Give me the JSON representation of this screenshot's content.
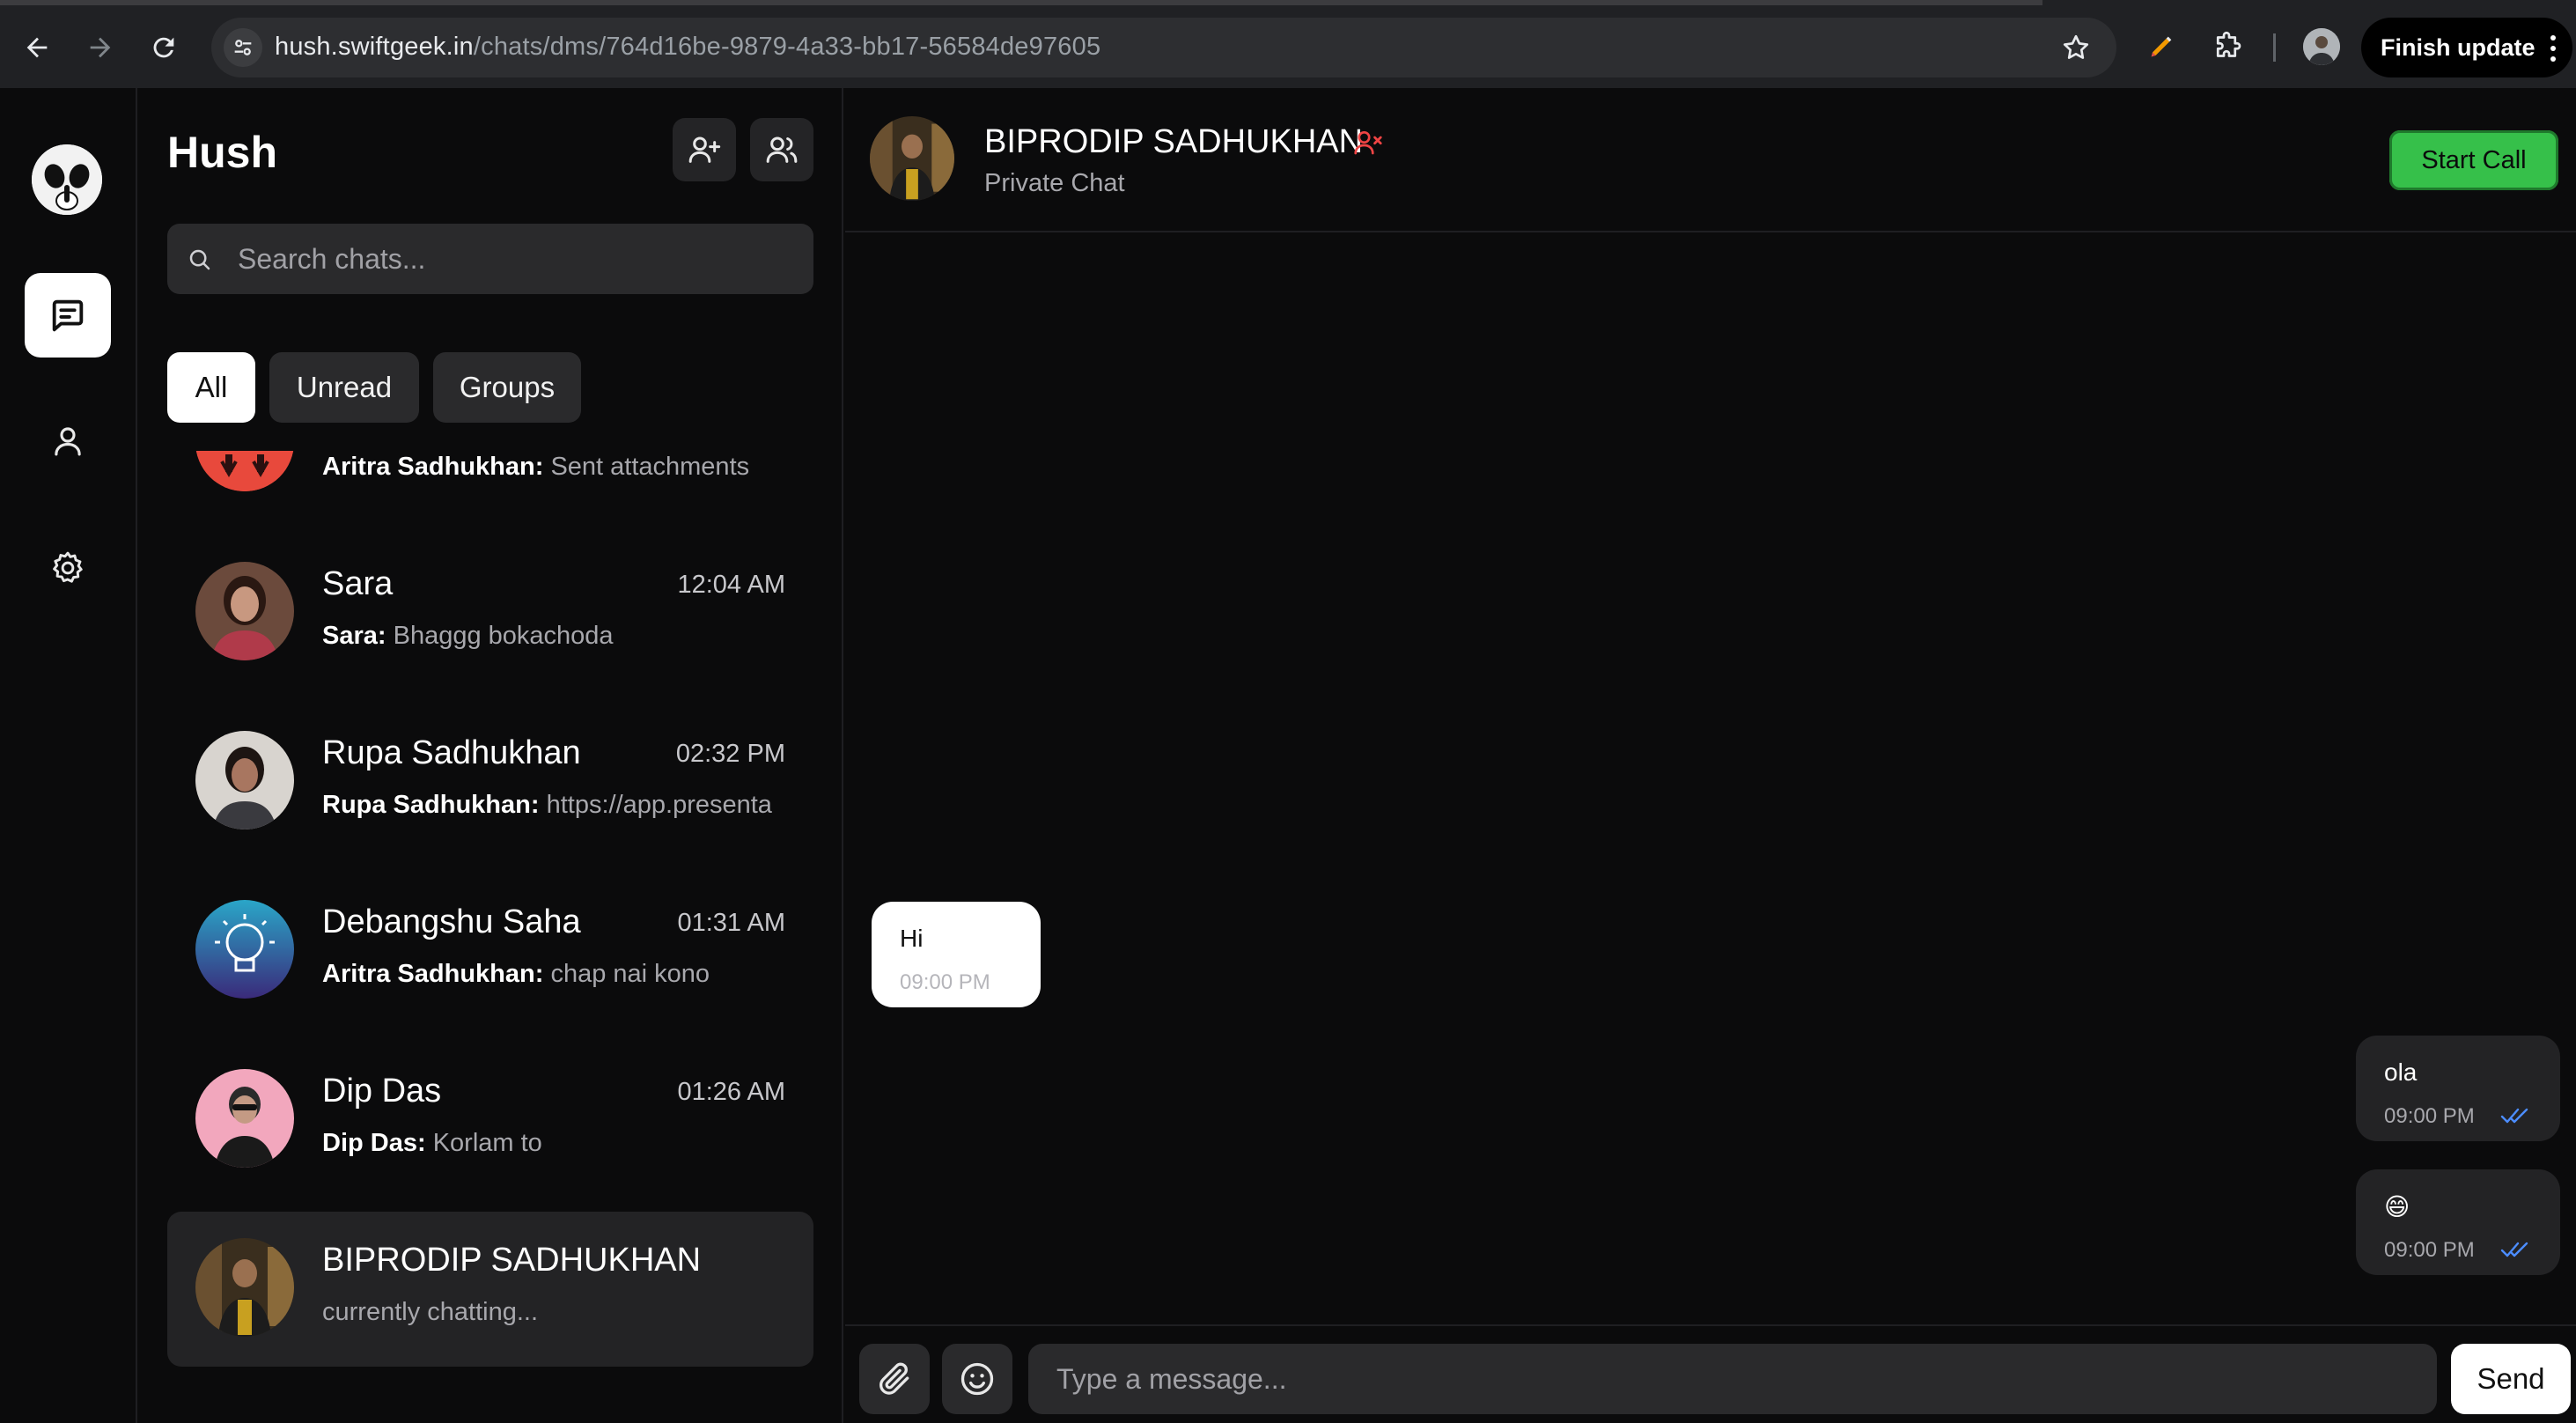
{
  "browser": {
    "url_host": "hush.swiftgeek.in",
    "url_path": "/chats/dms/764d16be-9879-4a33-bb17-56584de97605",
    "finish_update_label": "Finish update",
    "icons": [
      "back-icon",
      "forward-icon",
      "reload-icon",
      "tune-icon",
      "bookmark-star-icon",
      "pencil-extension-icon",
      "puzzle-extensions-icon",
      "more-vert-icon"
    ]
  },
  "rail": {
    "icons": [
      "hush-logo",
      "chat-icon",
      "user-icon",
      "gear-icon"
    ]
  },
  "sidebar": {
    "title": "Hush",
    "search_placeholder": "Search chats...",
    "filters": [
      "All",
      "Unread",
      "Groups"
    ],
    "active_filter": "All",
    "chats": [
      {
        "name": "",
        "time": "",
        "sender": "Aritra Sadhukhan:",
        "preview": "Sent attachments"
      },
      {
        "name": "Sara",
        "time": "12:04 AM",
        "sender": "Sara:",
        "preview": "Bhaggg bokachoda"
      },
      {
        "name": "Rupa Sadhukhan",
        "time": "02:32 PM",
        "sender": "Rupa Sadhukhan:",
        "preview": "https://app.presenta"
      },
      {
        "name": "Debangshu Saha",
        "time": "01:31 AM",
        "sender": "Aritra Sadhukhan:",
        "preview": "chap nai kono"
      },
      {
        "name": "Dip Das",
        "time": "01:26 AM",
        "sender": "Dip Das:",
        "preview": "Korlam to"
      },
      {
        "name": "BIPRODIP SADHUKHAN",
        "time": "",
        "sender": "",
        "preview": "currently chatting..."
      }
    ]
  },
  "conversation": {
    "name": "BIPRODIP SADHUKHAN",
    "subtitle": "Private Chat",
    "start_call_label": "Start Call",
    "messages": [
      {
        "direction": "in",
        "text": "Hi",
        "time": "09:00 PM"
      },
      {
        "direction": "out",
        "text": "ola",
        "time": "09:00 PM",
        "read": true
      },
      {
        "direction": "out",
        "text": "😄",
        "time": "09:00 PM",
        "read": true
      }
    ],
    "composer_placeholder": "Type a message...",
    "send_label": "Send"
  },
  "colors": {
    "accent_green": "#36c04a",
    "read_tick_blue": "#4c8dff",
    "remove_user_red": "#ef4444",
    "background": "#0b0b0c"
  }
}
